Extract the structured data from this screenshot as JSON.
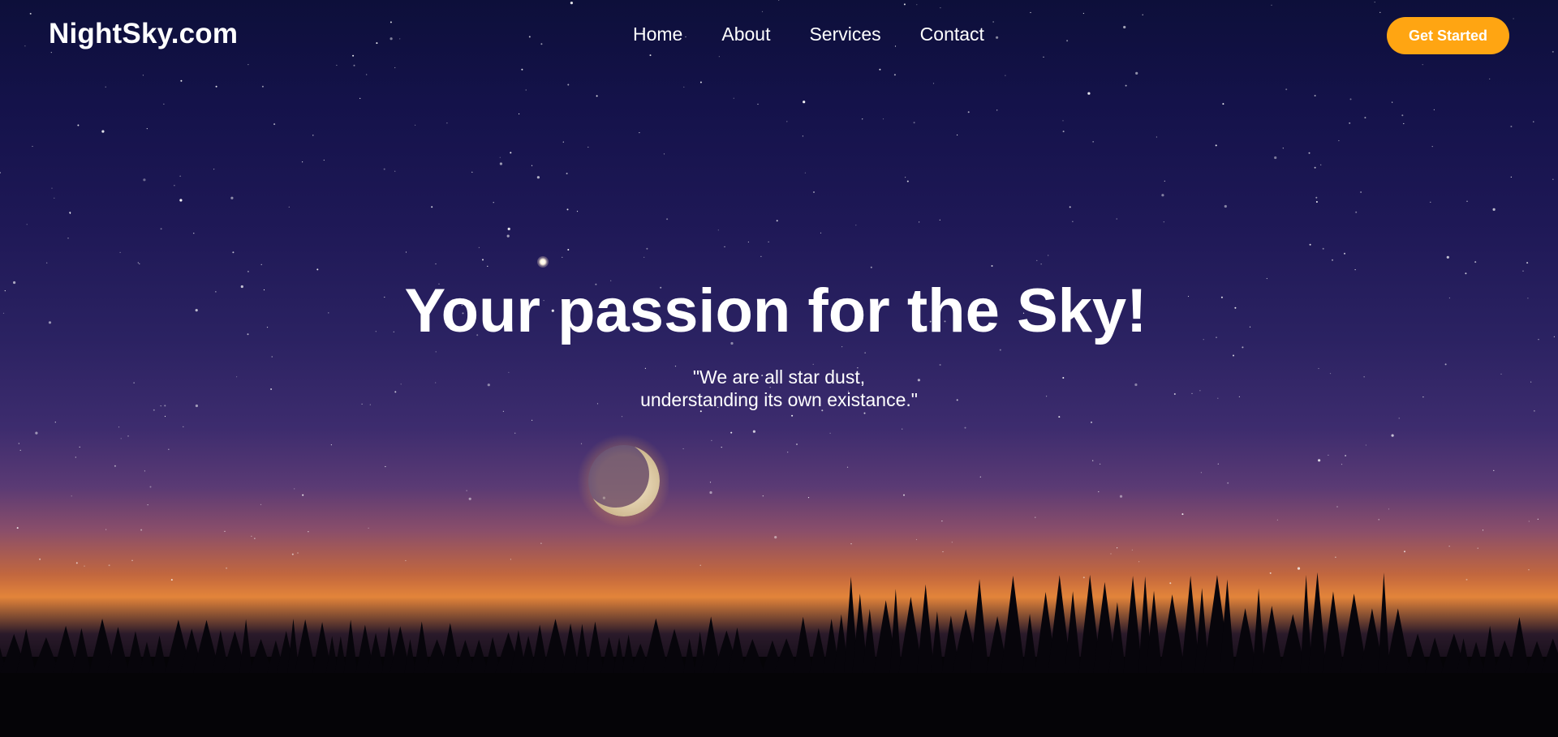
{
  "navbar": {
    "logo": "NightSky.com",
    "links": [
      "Home",
      "About",
      "Services",
      "Contact"
    ],
    "cta_label": "Get Started"
  },
  "hero": {
    "headline": "Your passion for the Sky!",
    "quote_line1": "\"We are all star dust,",
    "quote_line2": "understanding its own existance.\""
  },
  "colors": {
    "accent": "#ffa512",
    "sky_top": "#0d0f3a",
    "horizon_glow": "#e3843a",
    "text": "#ffffff"
  },
  "icons": {
    "background": "night-sky-photo",
    "moon": "crescent-moon",
    "trees": "forest-silhouette"
  }
}
